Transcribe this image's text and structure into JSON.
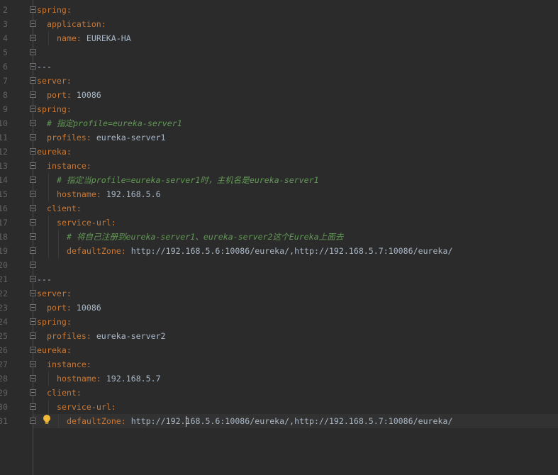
{
  "colors": {
    "background": "#2b2b2b",
    "key": "#cc7832",
    "value": "#a9b7c6",
    "comment": "#629755",
    "line_number": "#606366",
    "current_line": "#323232"
  },
  "colon": ":",
  "current_line": "31",
  "lines": [
    {
      "num": "2",
      "type": "key",
      "indent": 0,
      "key": "spring",
      "value": ""
    },
    {
      "num": "3",
      "type": "key",
      "indent": 1,
      "key": "application",
      "value": ""
    },
    {
      "num": "4",
      "type": "key",
      "indent": 2,
      "key": "name",
      "value": "EUREKA-HA"
    },
    {
      "num": "5",
      "type": "blank",
      "indent": 0
    },
    {
      "num": "6",
      "type": "separator",
      "indent": 0,
      "text": "---"
    },
    {
      "num": "7",
      "type": "key",
      "indent": 0,
      "key": "server",
      "value": ""
    },
    {
      "num": "8",
      "type": "key",
      "indent": 1,
      "key": "port",
      "value": "10086"
    },
    {
      "num": "9",
      "type": "key",
      "indent": 0,
      "key": "spring",
      "value": ""
    },
    {
      "num": "10",
      "type": "comment",
      "indent": 1,
      "text": "# 指定profile=eureka-server1"
    },
    {
      "num": "11",
      "type": "key",
      "indent": 1,
      "key": "profiles",
      "value": "eureka-server1"
    },
    {
      "num": "12",
      "type": "key",
      "indent": 0,
      "key": "eureka",
      "value": ""
    },
    {
      "num": "13",
      "type": "key",
      "indent": 1,
      "key": "instance",
      "value": ""
    },
    {
      "num": "14",
      "type": "comment",
      "indent": 2,
      "text": "# 指定当profile=eureka-server1时，主机名是eureka-server1"
    },
    {
      "num": "15",
      "type": "key",
      "indent": 2,
      "key": "hostname",
      "value": "192.168.5.6"
    },
    {
      "num": "16",
      "type": "key",
      "indent": 1,
      "key": "client",
      "value": ""
    },
    {
      "num": "17",
      "type": "key",
      "indent": 2,
      "key": "service-url",
      "value": ""
    },
    {
      "num": "18",
      "type": "comment",
      "indent": 3,
      "text": "# 将自己注册到eureka-server1、eureka-server2这个Eureka上面去"
    },
    {
      "num": "19",
      "type": "key",
      "indent": 3,
      "key": "defaultZone",
      "value": "http://192.168.5.6:10086/eureka/,http://192.168.5.7:10086/eureka/"
    },
    {
      "num": "20",
      "type": "blank",
      "indent": 0
    },
    {
      "num": "21",
      "type": "separator",
      "indent": 0,
      "text": "---"
    },
    {
      "num": "22",
      "type": "key",
      "indent": 0,
      "key": "server",
      "value": ""
    },
    {
      "num": "23",
      "type": "key",
      "indent": 1,
      "key": "port",
      "value": "10086"
    },
    {
      "num": "24",
      "type": "key",
      "indent": 0,
      "key": "spring",
      "value": ""
    },
    {
      "num": "25",
      "type": "key",
      "indent": 1,
      "key": "profiles",
      "value": "eureka-server2"
    },
    {
      "num": "26",
      "type": "key",
      "indent": 0,
      "key": "eureka",
      "value": ""
    },
    {
      "num": "27",
      "type": "key",
      "indent": 1,
      "key": "instance",
      "value": ""
    },
    {
      "num": "28",
      "type": "key",
      "indent": 2,
      "key": "hostname",
      "value": "192.168.5.7"
    },
    {
      "num": "29",
      "type": "key",
      "indent": 1,
      "key": "client",
      "value": ""
    },
    {
      "num": "30",
      "type": "key",
      "indent": 2,
      "key": "service-url",
      "value": ""
    },
    {
      "num": "31",
      "type": "key",
      "indent": 3,
      "key": "defaultZone",
      "value": "http://192.168.5.6:10086/eureka/,http://192.168.5.7:10086/eureka/"
    }
  ]
}
